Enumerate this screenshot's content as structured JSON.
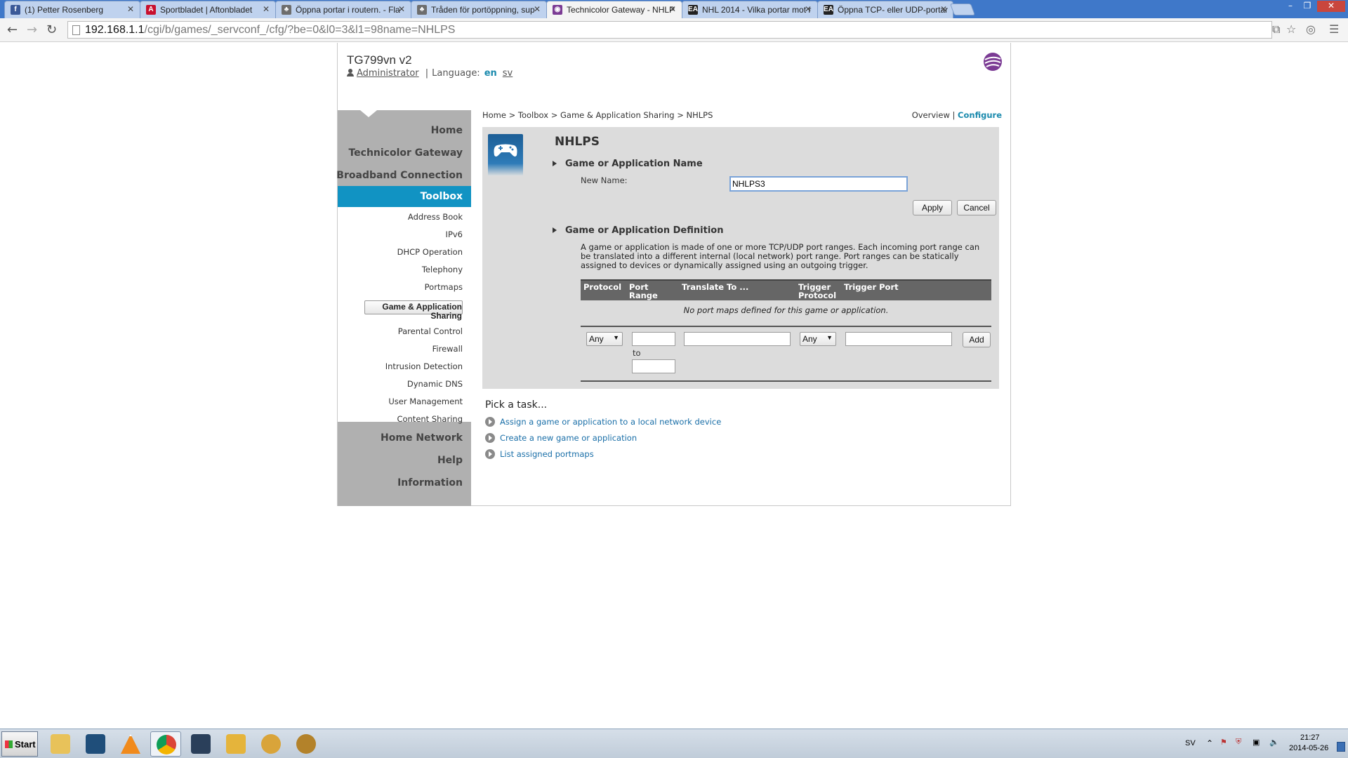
{
  "browser": {
    "tabs": [
      {
        "title": "(1) Petter Rosenberg",
        "icon": "facebook-icon",
        "color": "#3b5998",
        "glyph": "f"
      },
      {
        "title": "Sportbladet | Aftonbladet",
        "icon": "aftonbladet-icon",
        "color": "#c8102e",
        "glyph": "A"
      },
      {
        "title": "Öppna portar i routern. - Fla",
        "icon": "forum-icon",
        "color": "#6d6d6d",
        "glyph": "♣"
      },
      {
        "title": "Tråden för portöppning, sup",
        "icon": "forum-icon",
        "color": "#6d6d6d",
        "glyph": "♣"
      },
      {
        "title": "Technicolor Gateway - NHLP",
        "icon": "technicolor-icon",
        "color": "#7b3b94",
        "glyph": "◉",
        "active": true
      },
      {
        "title": "NHL 2014 - Vilka portar mot r",
        "icon": "ea-icon",
        "color": "#222222",
        "glyph": "EA"
      },
      {
        "title": "Öppna TCP- eller UDP-portar",
        "icon": "ea-icon",
        "color": "#222222",
        "glyph": "EA"
      }
    ],
    "url_host": "192.168.1.1",
    "url_path": "/cgi/b/games/_servconf_/cfg/?be=0&l0=3&l1=98name=NHLPS"
  },
  "header": {
    "device": "TG799vn v2",
    "user": "Administrator",
    "language_label": "Language:",
    "lang_en": "en",
    "lang_sv": "sv"
  },
  "sidebar": {
    "main_top": [
      "Home",
      "Technicolor Gateway",
      "Broadband Connection"
    ],
    "toolbox": "Toolbox",
    "sub": [
      "Address Book",
      "IPv6",
      "DHCP Operation",
      "Telephony",
      "Portmaps",
      "Game & Application Sharing",
      "Parental Control",
      "Firewall",
      "Intrusion Detection",
      "Dynamic DNS",
      "User Management",
      "Content Sharing"
    ],
    "main_bottom": [
      "Home Network",
      "Help",
      "Information"
    ]
  },
  "breadcrumb": "Home > Toolbox > Game & Application Sharing > NHLPS",
  "view": {
    "overview": "Overview",
    "sep": "|",
    "configure": "Configure"
  },
  "panel": {
    "title": "NHLPS",
    "name_section": "Game or Application Name",
    "new_name_label": "New Name:",
    "new_name_value": "NHLPS3",
    "apply": "Apply",
    "cancel": "Cancel",
    "def_section": "Game or Application Definition",
    "description": "A game or application is made of one or more TCP/UDP port ranges. Each incoming port range can be translated into a different internal (local network) port range. Port ranges can be statically assigned to devices or dynamically assigned using an outgoing trigger.",
    "columns": [
      "Protocol",
      "Port Range",
      "Translate To ...",
      "Trigger Protocol",
      "Trigger Port"
    ],
    "empty": "No port maps defined for this game or application.",
    "protocol_value": "Any",
    "trigger_protocol_value": "Any",
    "to_label": "to",
    "add": "Add"
  },
  "tasks": {
    "title": "Pick a task...",
    "items": [
      "Assign a game or application to a local network device",
      "Create a new game or application",
      "List assigned portmaps"
    ]
  },
  "taskbar": {
    "start": "Start",
    "lang": "SV",
    "time": "21:27",
    "date": "2014-05-26"
  },
  "colors": {
    "accent": "#1193c3",
    "link": "#1a6fa8",
    "sidebar": "#b0b0b0"
  }
}
